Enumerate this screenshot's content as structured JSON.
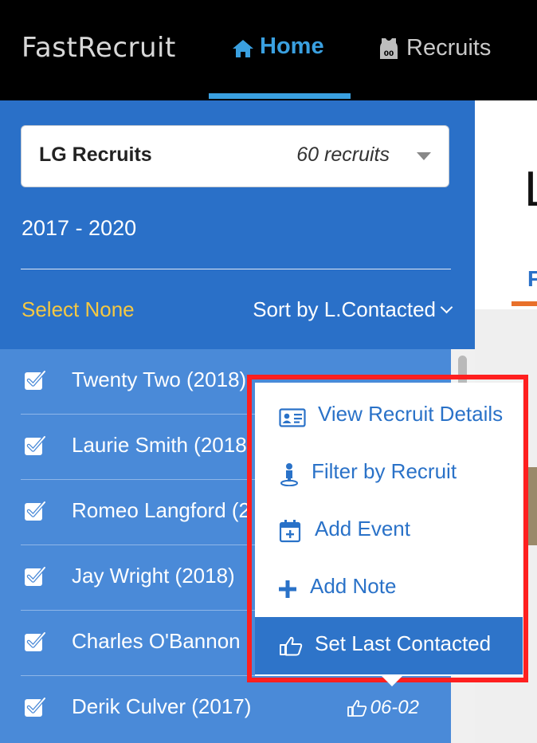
{
  "nav": {
    "brand": "FastRecruit",
    "home_label": "Home",
    "recruits_label": "Recruits",
    "home_icon": "home-icon",
    "recruits_icon": "jersey-icon"
  },
  "panel": {
    "list_name": "LG Recruits",
    "list_count": "60 recruits",
    "years": "2017 - 2020",
    "select_none": "Select None",
    "sort_by": "Sort by L.Contacted"
  },
  "recruits": [
    {
      "name": "Twenty Two (2018)",
      "checked": true
    },
    {
      "name": "Laurie Smith (2018",
      "checked": true
    },
    {
      "name": "Romeo Langford (2",
      "checked": true
    },
    {
      "name": "Jay Wright (2018)",
      "checked": true
    },
    {
      "name": "Charles O'Bannon",
      "checked": true
    },
    {
      "name": "Derik Culver (2017)",
      "checked": true,
      "last_contacted": "06-02"
    }
  ],
  "menu": {
    "items": [
      {
        "label": "View Recruit Details",
        "icon": "id-card-icon"
      },
      {
        "label": "Filter by Recruit",
        "icon": "person-pin-icon"
      },
      {
        "label": "Add Event",
        "icon": "calendar-plus-icon"
      },
      {
        "label": "Add Note",
        "icon": "plus-icon"
      },
      {
        "label": "Set Last Contacted",
        "icon": "thumbs-up-icon",
        "active": true
      }
    ]
  },
  "right": {
    "heading_fragment": "L",
    "tab_fragment": "F"
  },
  "colors": {
    "nav_bg": "#000000",
    "accent": "#3aa0e0",
    "panel_blue": "#2a70c8",
    "list_blue": "#4a8ad8",
    "highlight_red": "#ff1f1f",
    "select_none": "#f5c842",
    "tab_underline": "#e8702a"
  }
}
